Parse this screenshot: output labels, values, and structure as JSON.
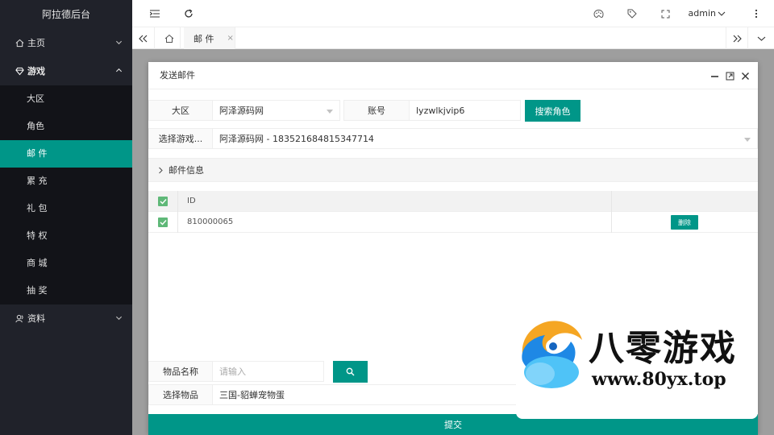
{
  "app": {
    "brand": "阿拉德后台"
  },
  "sidebar": {
    "home": {
      "label": "主页",
      "icon": "home-icon"
    },
    "game": {
      "label": "游戏",
      "icon": "diamond-icon",
      "items": [
        {
          "label": "大区"
        },
        {
          "label": "角色"
        },
        {
          "label": "邮 件",
          "active": true
        },
        {
          "label": "累 充"
        },
        {
          "label": "礼 包"
        },
        {
          "label": "特 权"
        },
        {
          "label": "商 城"
        },
        {
          "label": "抽 奖"
        }
      ]
    },
    "profile": {
      "label": "资料",
      "icon": "user-icon"
    }
  },
  "header": {
    "user": "admin"
  },
  "tabs": {
    "current": "邮 件",
    "close": "×"
  },
  "dialog": {
    "title": "发送邮件",
    "region_label": "大区",
    "region_value": "阿泽源码网",
    "account_label": "账号",
    "account_value": "lyzwlkjvip6",
    "search_role_btn": "搜索角色",
    "select_role_label": "选择游戏...",
    "select_role_value": "阿泽源码网 - 183521684815347714",
    "mail_info": "邮件信息",
    "table": {
      "header_id": "ID",
      "rows": [
        {
          "id": "810000065",
          "delete": "删除"
        }
      ]
    },
    "item_name_label": "物品名称",
    "item_name_placeholder": "请输入",
    "select_item_label": "选择物品",
    "select_item_value": "三国-貂蝉宠物蛋",
    "submit": "提交"
  },
  "watermark": {
    "title": "八零游戏",
    "url": "www.80yx.top"
  },
  "colors": {
    "accent": "#009688",
    "sidebar": "#20222a",
    "checkbox": "#5fb878"
  }
}
